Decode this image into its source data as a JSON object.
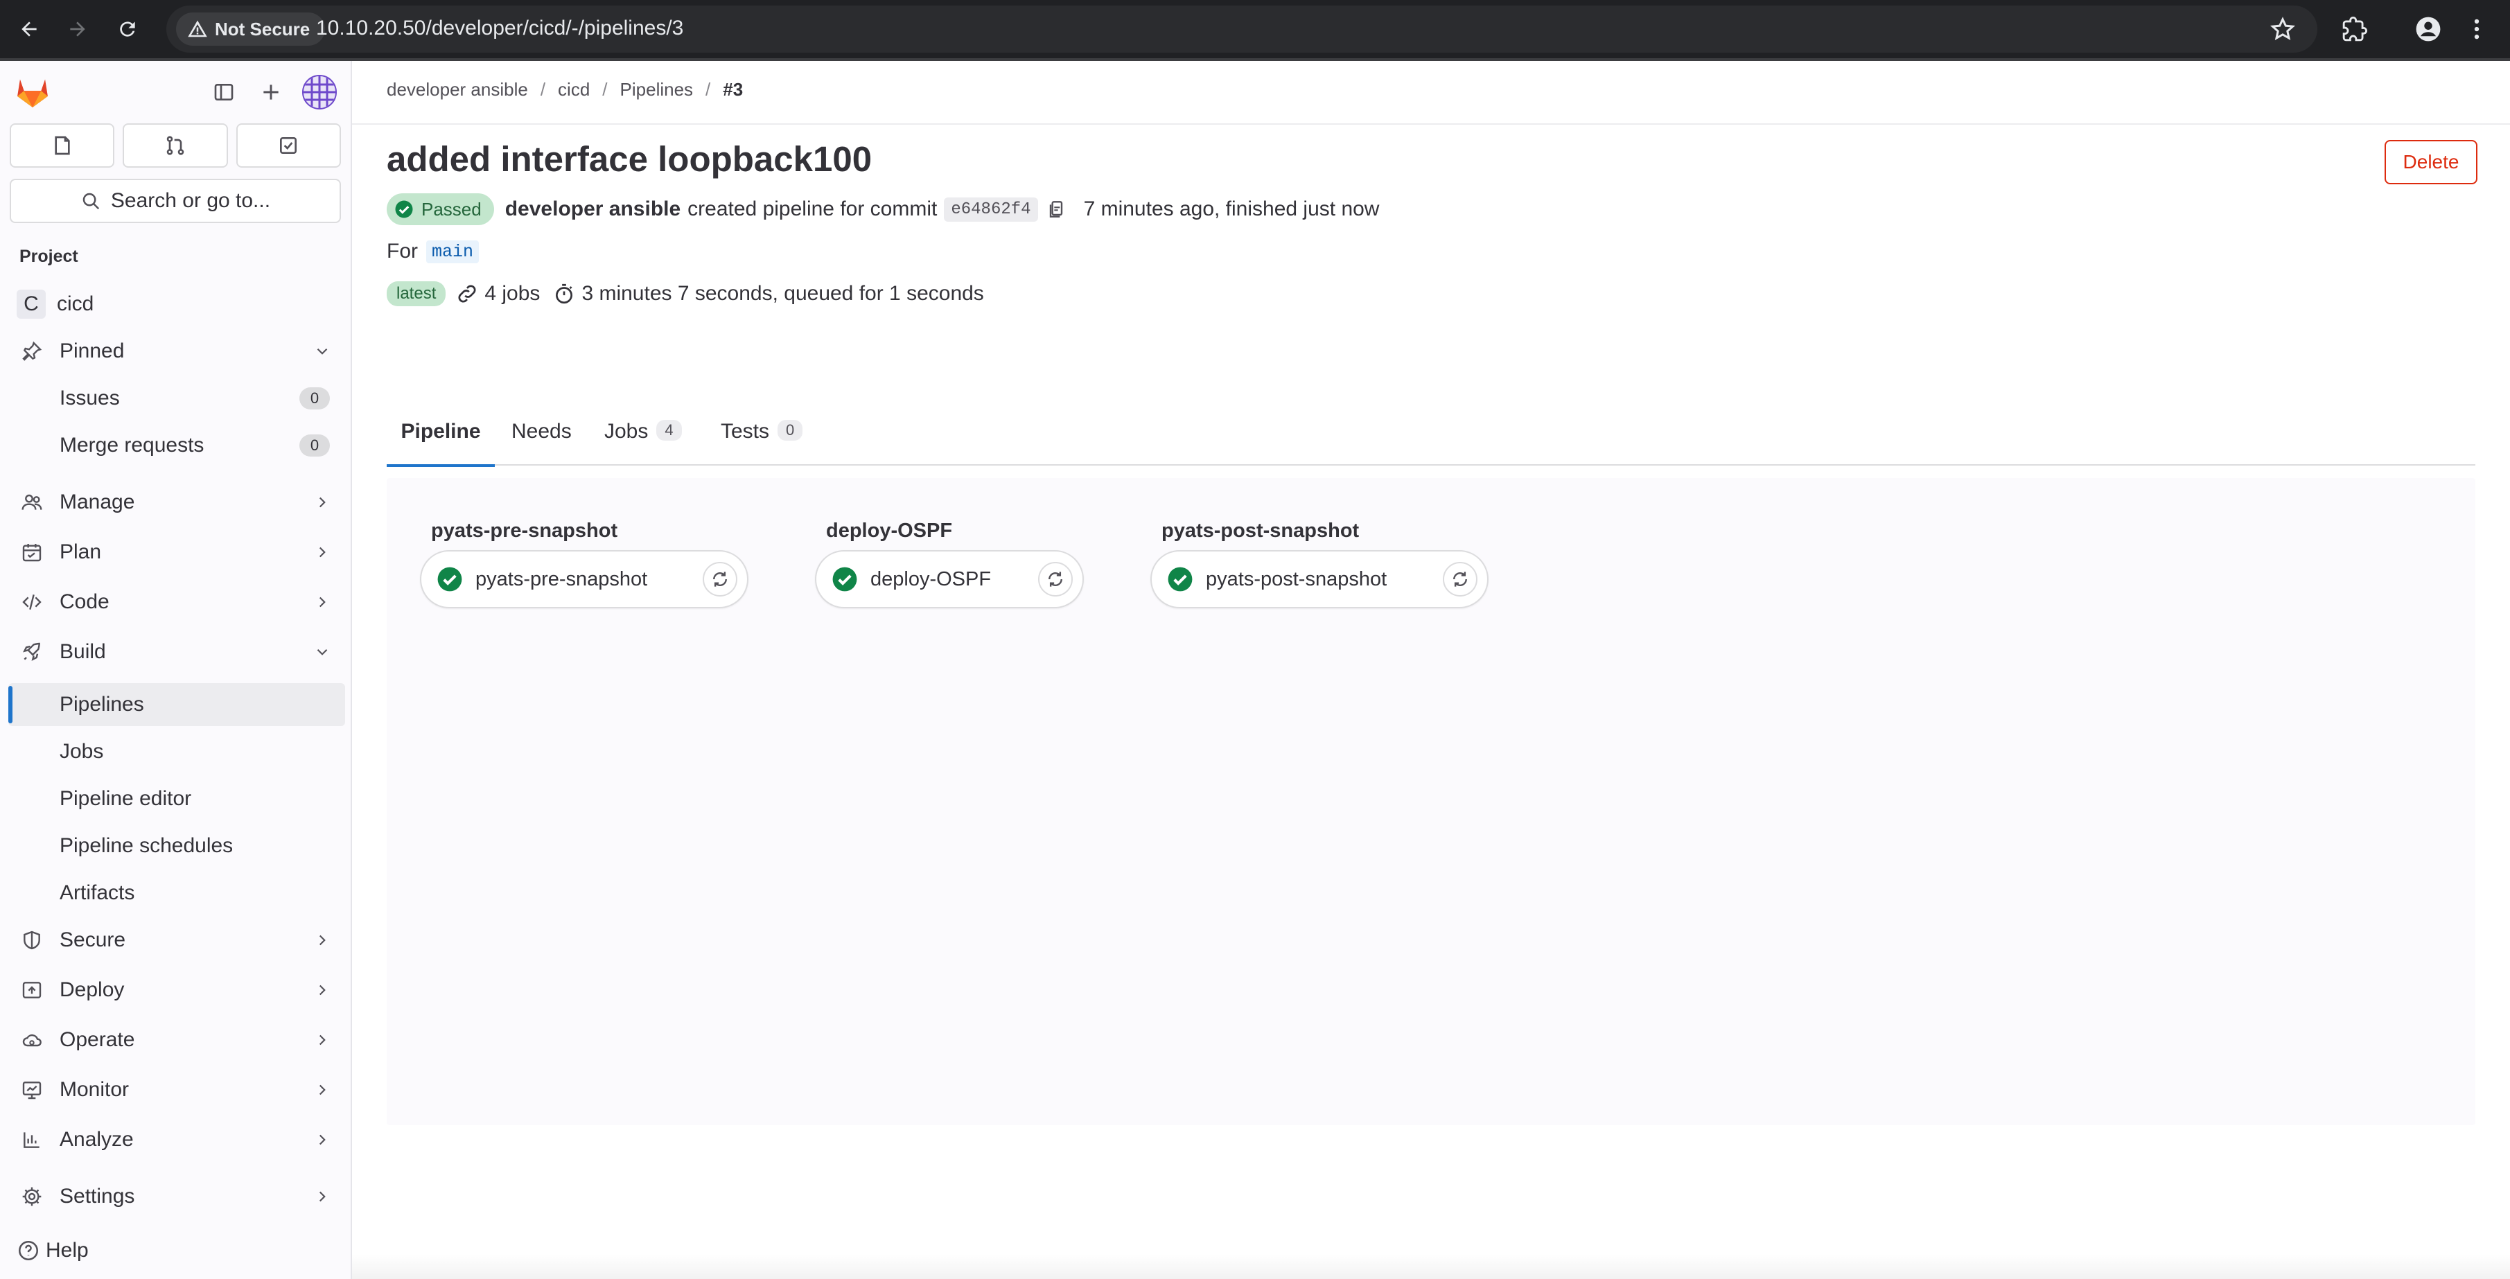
{
  "browser": {
    "security_label": "Not Secure",
    "url": "10.10.20.50/developer/cicd/-/pipelines/3"
  },
  "sidebar": {
    "search_label": "Search or go to...",
    "section_title": "Project",
    "project": {
      "initial": "C",
      "name": "cicd"
    },
    "pinned_label": "Pinned",
    "pinned_items": [
      {
        "label": "Issues",
        "count": "0"
      },
      {
        "label": "Merge requests",
        "count": "0"
      }
    ],
    "groups": {
      "manage": "Manage",
      "plan": "Plan",
      "code": "Code",
      "build": "Build",
      "secure": "Secure",
      "deploy": "Deploy",
      "operate": "Operate",
      "monitor": "Monitor",
      "analyze": "Analyze",
      "settings": "Settings"
    },
    "build_items": [
      "Pipelines",
      "Jobs",
      "Pipeline editor",
      "Pipeline schedules",
      "Artifacts"
    ],
    "help_label": "Help"
  },
  "breadcrumb": [
    "developer ansible",
    "cicd",
    "Pipelines",
    "#3"
  ],
  "pipeline": {
    "title": "added interface loopback100",
    "delete_label": "Delete",
    "status": "Passed",
    "author": "developer ansible",
    "created_text": "created pipeline for commit",
    "commit_sha": "e64862f4",
    "time_text": "7 minutes ago, finished just now",
    "for_label": "For",
    "branch": "main",
    "latest_badge": "latest",
    "jobs_text": "4 jobs",
    "duration_text": "3 minutes 7 seconds, queued for 1 seconds"
  },
  "tabs": [
    {
      "label": "Pipeline",
      "count": null
    },
    {
      "label": "Needs",
      "count": null
    },
    {
      "label": "Jobs",
      "count": "4"
    },
    {
      "label": "Tests",
      "count": "0"
    }
  ],
  "stages": [
    {
      "name": "pyats-pre-snapshot",
      "job": "pyats-pre-snapshot",
      "status": "passed"
    },
    {
      "name": "deploy-OSPF",
      "job": "deploy-OSPF",
      "status": "passed"
    },
    {
      "name": "pyats-post-snapshot",
      "job": "pyats-post-snapshot",
      "status": "passed"
    }
  ],
  "colors": {
    "success": "#108548",
    "success_bg": "#c3e6cd",
    "accent": "#1f75cb",
    "danger": "#dd2b0e"
  }
}
